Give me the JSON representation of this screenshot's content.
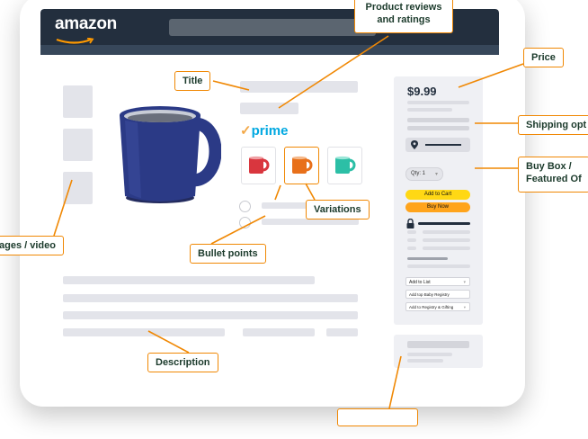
{
  "header": {
    "logo_text": "amazon"
  },
  "product": {
    "prime_label": "prime",
    "prime_check": "✓"
  },
  "buy_box": {
    "price": "$9.99",
    "qty_label": "Qty: 1",
    "add_to_cart": "Add to Cart",
    "buy_now": "Buy Now",
    "add_to_list": "Add to List",
    "baby_registry": "Add top Baby Registry",
    "registry_gifting": "Add to Registry & Gifting"
  },
  "variations": [
    {
      "color": "#d9363e"
    },
    {
      "color": "#e8701a"
    },
    {
      "color": "#2cbfa6"
    }
  ],
  "annotations": {
    "reviews": [
      "Product reviews",
      "and ratings"
    ],
    "title": "Title",
    "price": "Price",
    "shipping": "Shipping opt",
    "buybox": [
      "Buy Box /",
      "Featured Of"
    ],
    "variations": "Variations",
    "bullets": "Bullet points",
    "images": "ages / video",
    "description": "Description"
  },
  "colors": {
    "callout_border": "#f08804",
    "callout_text": "#1b3a2b",
    "header_bg": "#232f3e",
    "mug": "#2b3a86"
  }
}
